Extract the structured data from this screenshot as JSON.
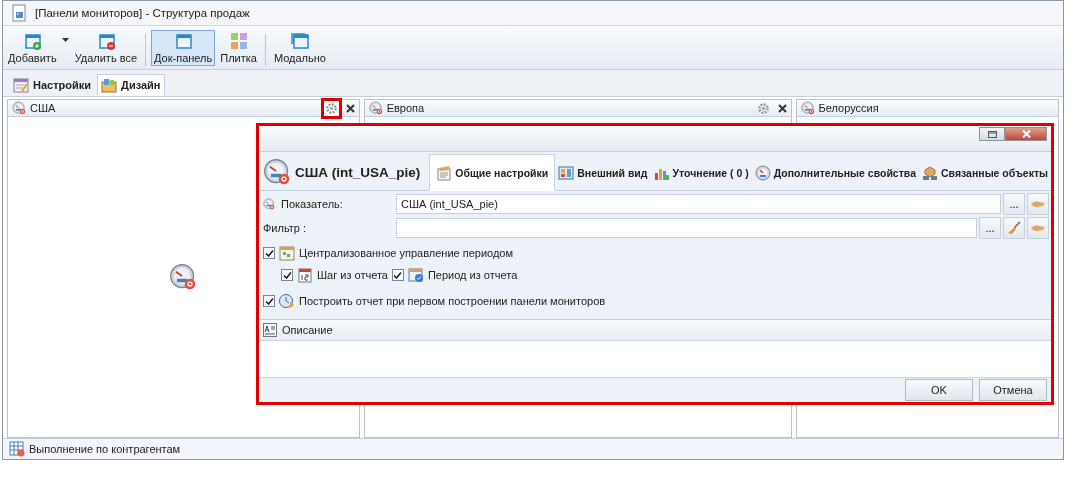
{
  "window": {
    "title": "[Панели мониторов] - Структура продаж"
  },
  "toolbar": [
    {
      "label": "Добавить",
      "selected": false,
      "kind": "add"
    },
    {
      "label": "Удалить все",
      "selected": false,
      "kind": "remove"
    },
    {
      "label": "Док-панель",
      "selected": true,
      "kind": "dock"
    },
    {
      "label": "Плитка",
      "selected": false,
      "kind": "tile"
    },
    {
      "label": "Модально",
      "selected": false,
      "kind": "modal"
    }
  ],
  "tabs": [
    {
      "label": "Настройки",
      "selected": false,
      "kind": "settings"
    },
    {
      "label": "Дизайн",
      "selected": true,
      "kind": "design"
    }
  ],
  "panels": [
    {
      "title": "США",
      "buttons": true,
      "settings_highlighted": true,
      "placeholder_icon": true
    },
    {
      "title": "Европа",
      "buttons": true,
      "settings_highlighted": false
    },
    {
      "title": "Белоруссия",
      "buttons": false
    }
  ],
  "status_bar": {
    "text": "Выполнение по контрагентам"
  },
  "dialog": {
    "highlighted": true,
    "title": "США (int_USA_pie)",
    "tabs": [
      {
        "label": "Общие настройки",
        "selected": true,
        "kind": "general"
      },
      {
        "label": "Внешний вид",
        "selected": false,
        "kind": "view"
      },
      {
        "label": "Уточнение ( 0 )",
        "selected": false,
        "kind": "refine"
      },
      {
        "label": "Дополнительные свойства",
        "selected": false,
        "kind": "extra"
      },
      {
        "label": "Связанные объекты",
        "selected": false,
        "kind": "linked"
      }
    ],
    "fields": [
      {
        "label": "Показатель:",
        "kind": "indicator",
        "value": "США (int_USA_pie)",
        "buttons": [
          {
            "kind": "browse",
            "label": "..."
          },
          {
            "kind": "link"
          }
        ]
      },
      {
        "label": "Фильтр :",
        "kind": "filter",
        "buttons": [
          {
            "kind": "browse",
            "label": "..."
          },
          {
            "kind": "clear"
          },
          {
            "kind": "link"
          }
        ]
      }
    ],
    "options": [
      {
        "label": "Централизованное управление периодом",
        "checked": true,
        "kind": "period",
        "children": [
          {
            "label": "Шаг из отчета",
            "checked": true,
            "kind": "step"
          },
          {
            "label": "Период из отчета",
            "checked": true,
            "kind": "range"
          }
        ]
      },
      {
        "label": "Построить отчет при первом построении панели мониторов",
        "checked": true,
        "kind": "build"
      }
    ],
    "description": {
      "label": "Описание"
    },
    "buttons": [
      "OK",
      "Отмена"
    ]
  }
}
